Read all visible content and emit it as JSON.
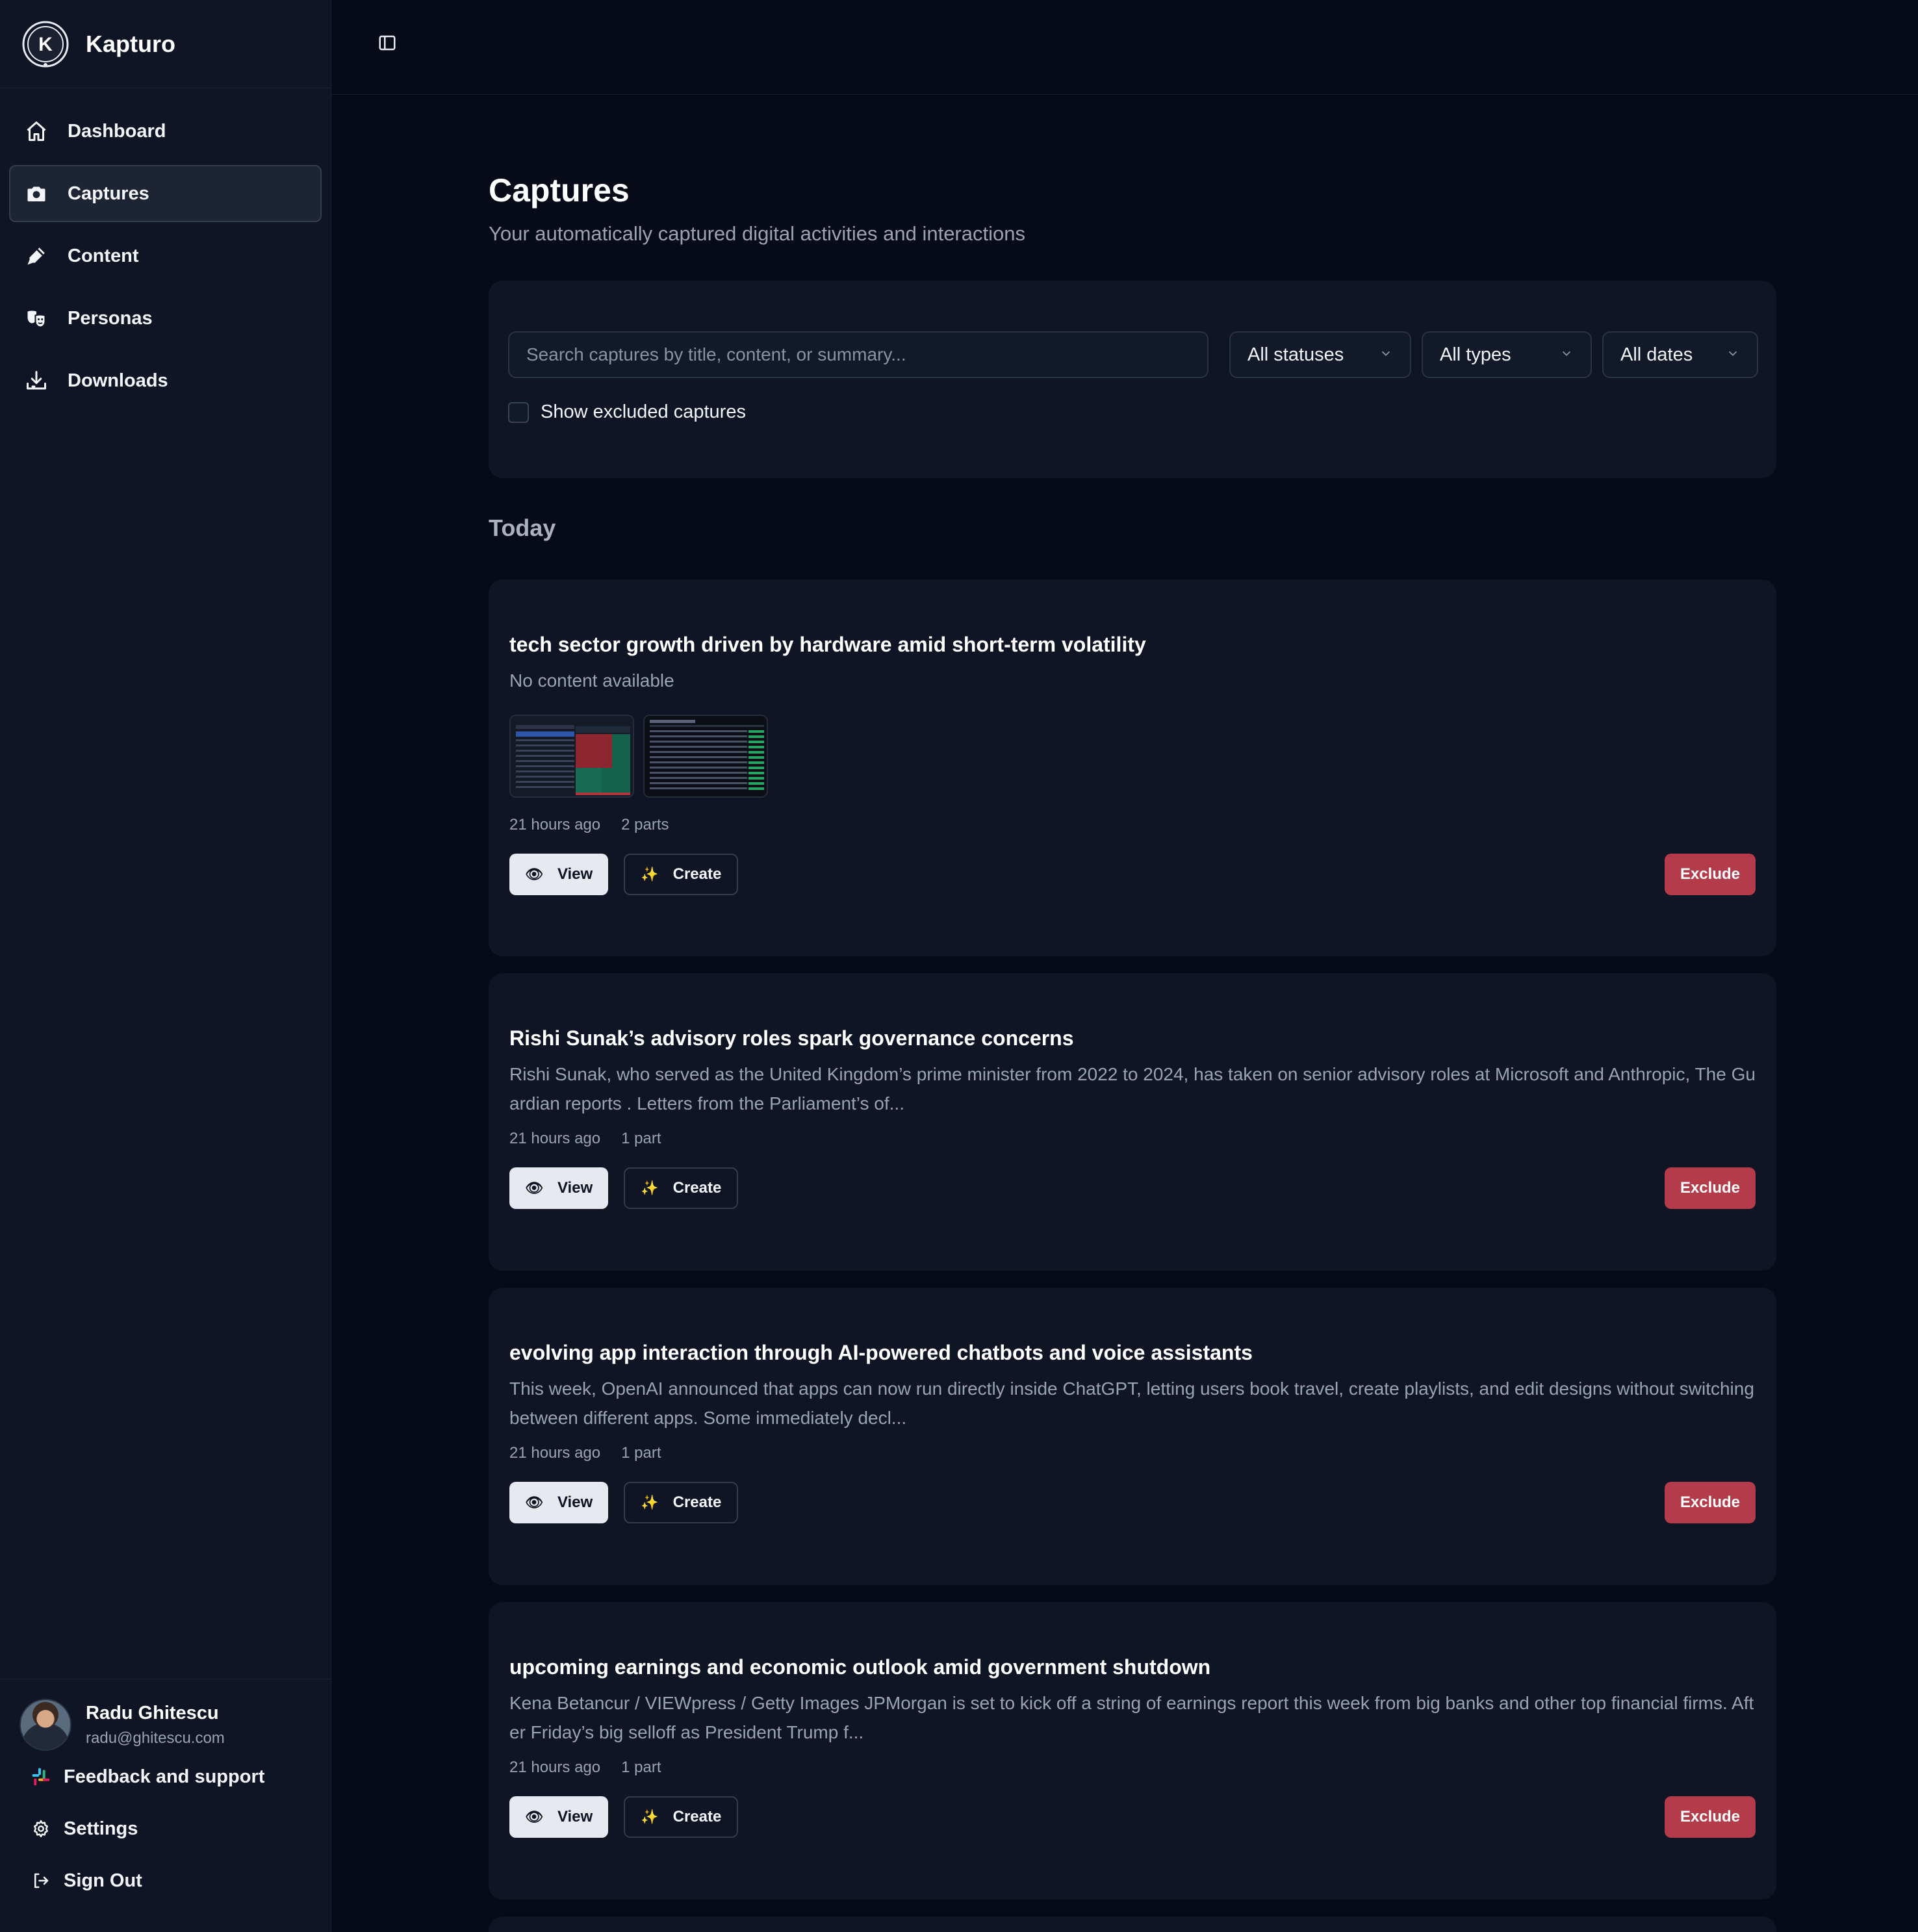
{
  "app": {
    "name": "Kapturo"
  },
  "nav": [
    {
      "label": "Dashboard",
      "icon": "home-icon"
    },
    {
      "label": "Captures",
      "icon": "camera-icon",
      "active": true
    },
    {
      "label": "Content",
      "icon": "pen-icon"
    },
    {
      "label": "Personas",
      "icon": "masks-icon"
    },
    {
      "label": "Downloads",
      "icon": "download-icon"
    }
  ],
  "user": {
    "name": "Radu Ghitescu",
    "email": "radu@ghitescu.com"
  },
  "footer_links": [
    {
      "label": "Feedback and support",
      "icon": "slack-icon"
    },
    {
      "label": "Settings",
      "icon": "gear-icon"
    },
    {
      "label": "Sign Out",
      "icon": "sign-out-icon"
    }
  ],
  "page": {
    "title": "Captures",
    "subtitle": "Your automatically captured digital activities and interactions"
  },
  "filters": {
    "search_placeholder": "Search captures by title, content, or summary...",
    "status": "All statuses",
    "type": "All types",
    "date": "All dates",
    "show_excluded_label": "Show excluded captures",
    "show_excluded": false
  },
  "group": {
    "title": "Today"
  },
  "buttons": {
    "view": "View",
    "create": "Create",
    "exclude": "Exclude"
  },
  "captures": [
    {
      "title": "tech sector growth driven by hardware amid short-term volatility",
      "body": "No content available",
      "time": "21 hours ago",
      "parts": "2 parts",
      "has_thumbnails": true
    },
    {
      "title": "Rishi Sunak’s advisory roles spark governance concerns",
      "body": "Rishi Sunak, who served as the United Kingdom’s prime minister from 2022 to 2024, has taken on senior advisory roles at Microsoft and Anthropic, The Guardian reports . Letters from the Parliament’s of...",
      "time": "21 hours ago",
      "parts": "1 part"
    },
    {
      "title": "evolving app interaction through AI-powered chatbots and voice assistants",
      "body": "This week, OpenAI announced that apps can now run directly inside ChatGPT, letting users book travel, create playlists, and edit designs without switching between different apps. Some immediately decl...",
      "time": "21 hours ago",
      "parts": "1 part"
    },
    {
      "title": "upcoming earnings and economic outlook amid government shutdown",
      "body": "Kena Betancur / VIEWpress / Getty Images JPMorgan is set to kick off a string of earnings report this week from big banks and other top financial firms. After Friday’s big selloff as President Trump f...",
      "time": "21 hours ago",
      "parts": "1 part"
    }
  ],
  "colors": {
    "background": "#070b17",
    "panel": "#0f1524",
    "exclude": "#b43c4a",
    "muted_text": "#9aa3b4"
  }
}
